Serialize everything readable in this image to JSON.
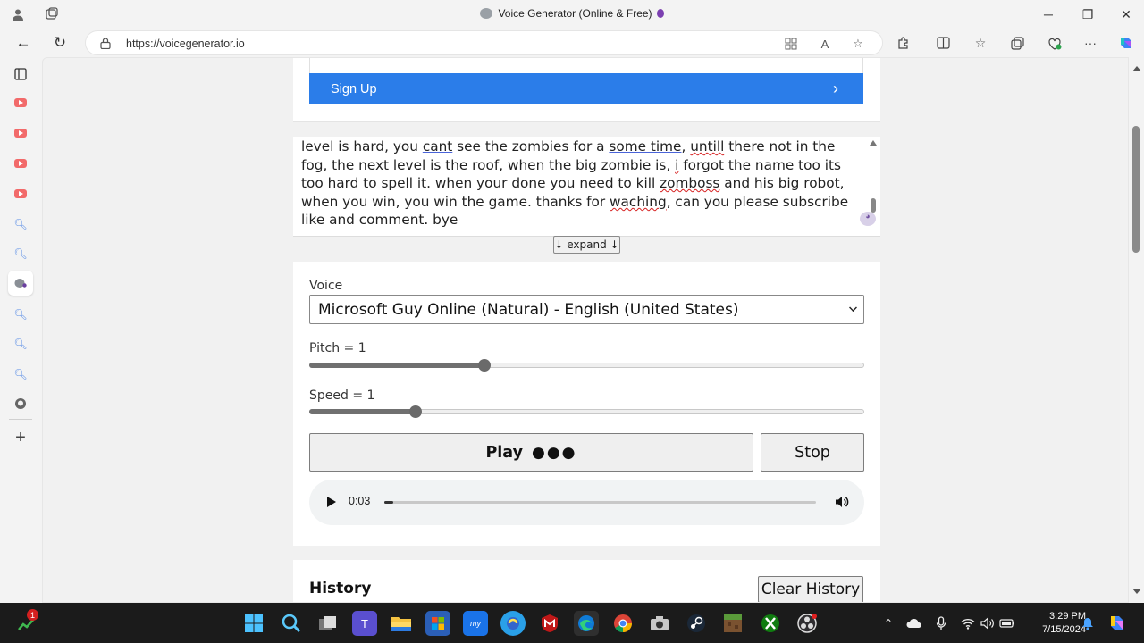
{
  "window": {
    "title": "Voice Generator (Online & Free)",
    "minimize": "─",
    "maximize": "❐",
    "close": "✕"
  },
  "browser": {
    "url": "https://voicegenerator.io",
    "back_icon": "←",
    "refresh_icon": "↻"
  },
  "page": {
    "signup_label": "Sign Up",
    "signup_chevron": "›",
    "text_segments": [
      {
        "t": "level is hard, you ",
        "s": ""
      },
      {
        "t": "cant",
        "s": "ul"
      },
      {
        "t": " see the zombies for a ",
        "s": ""
      },
      {
        "t": "some time",
        "s": "ul"
      },
      {
        "t": ", ",
        "s": ""
      },
      {
        "t": "untill",
        "s": "sp"
      },
      {
        "t": " there not in the fog, the next level is the roof, when the big zombie is, ",
        "s": ""
      },
      {
        "t": "i",
        "s": "sp"
      },
      {
        "t": " forgot the name too ",
        "s": ""
      },
      {
        "t": "its",
        "s": "ul"
      },
      {
        "t": " too hard to spell it. when your done you need to kill ",
        "s": ""
      },
      {
        "t": "zomboss",
        "s": "sp"
      },
      {
        "t": " and his big robot, when you win, you win the game. thanks for ",
        "s": ""
      },
      {
        "t": "waching",
        "s": "sp"
      },
      {
        "t": ", can you please subscribe like and comment. bye",
        "s": ""
      }
    ],
    "expand_label": "↓ expand ↓",
    "voice_label": "Voice",
    "voice_selected": "Microsoft Guy Online (Natural) - English (United States)",
    "pitch_label": "Pitch = 1",
    "pitch_fraction": 0.315,
    "speed_label": "Speed = 1",
    "speed_fraction": 0.192,
    "play_label": "Play",
    "play_dots": "●●●",
    "stop_label": "Stop",
    "audio_time": "0:03",
    "audio_progress": 0.02,
    "history_title": "History",
    "clear_history_label": "Clear History"
  },
  "taskbar": {
    "notification_count": "1",
    "time": "3:29 PM",
    "date": "7/15/2024"
  },
  "colors": {
    "accent": "#2b7de9"
  }
}
